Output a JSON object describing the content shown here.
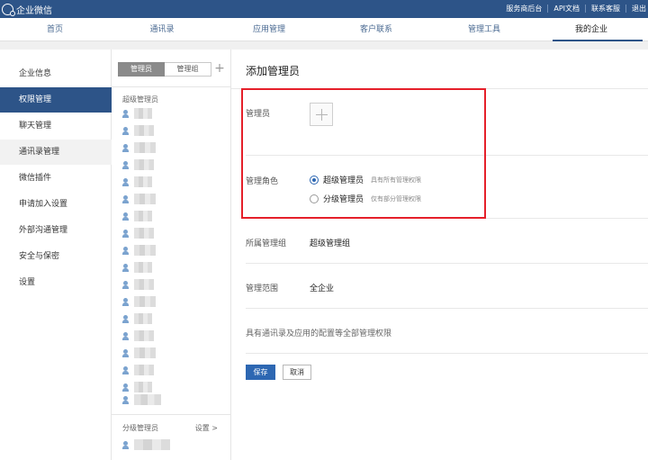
{
  "app": {
    "title": "企业微信"
  },
  "top_links": [
    "服务商后台",
    "API文档",
    "联系客服",
    "退出"
  ],
  "nav": {
    "tabs": [
      "首页",
      "通讯录",
      "应用管理",
      "客户联系",
      "管理工具",
      "我的企业"
    ],
    "active": "我的企业"
  },
  "sidebar": {
    "items": [
      "企业信息",
      "权限管理",
      "聊天管理",
      "通讯录管理",
      "微信插件",
      "申请加入设置",
      "外部沟通管理",
      "安全与保密",
      "设置"
    ],
    "active": "权限管理"
  },
  "member_panel": {
    "tabs": [
      "管理员",
      "管理组"
    ],
    "active_tab": "管理员",
    "add_icon": "plus-icon",
    "super_title": "超级管理员",
    "sub_title": "分级管理员",
    "settings_link": "设置 >"
  },
  "form": {
    "title": "添加管理员",
    "admin_label": "管理员",
    "role_label": "管理角色",
    "roles": [
      {
        "label": "超级管理员",
        "desc": "具有所有管理权限",
        "checked": true
      },
      {
        "label": "分级管理员",
        "desc": "仅有部分管理权限",
        "checked": false
      }
    ],
    "group_label": "所属管理组",
    "group_value": "超级管理组",
    "scope_label": "管理范围",
    "scope_value": "全企业",
    "permission_desc": "具有通讯录及应用的配置等全部管理权限",
    "save_label": "保存",
    "cancel_label": "取消"
  },
  "colors": {
    "header": "#2d5488",
    "accent": "#2d67b2",
    "highlight": "#e5202a"
  }
}
